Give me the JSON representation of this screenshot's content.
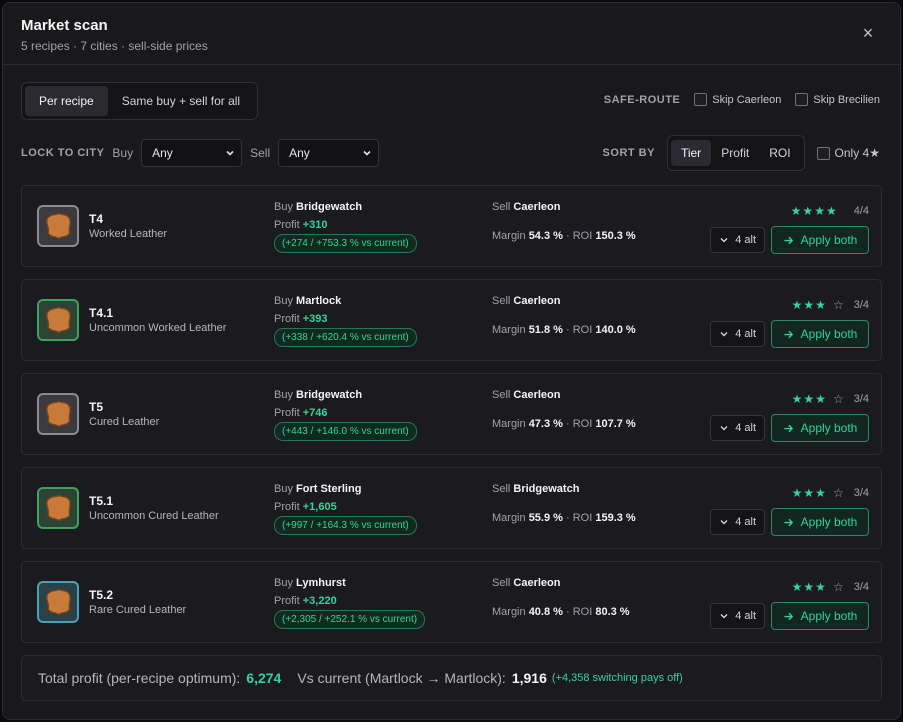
{
  "header": {
    "title": "Market scan",
    "subtitle": "5 recipes · 7 cities · sell-side prices",
    "close": "×"
  },
  "mode_tabs": [
    "Per recipe",
    "Same buy + sell for all"
  ],
  "safe_route": {
    "label": "SAFE-ROUTE",
    "options": [
      "Skip Caerleon",
      "Skip Brecilien"
    ]
  },
  "lock": {
    "label": "LOCK TO CITY",
    "buy_label": "Buy",
    "buy_value": "Any",
    "sell_label": "Sell",
    "sell_value": "Any"
  },
  "sort": {
    "label": "SORT BY",
    "options": [
      "Tier",
      "Profit",
      "ROI"
    ],
    "active": "Tier",
    "only_label": "Only 4★"
  },
  "recipes": [
    {
      "tier": "T4",
      "name": "Worked Leather",
      "buy_label": "Buy",
      "buy_city": "Bridgewatch",
      "profit_label": "Profit",
      "profit": "+310",
      "delta": "(+274 / +753.3 % vs current)",
      "sell_label": "Sell",
      "sell_city": "Caerleon",
      "margin_label": "Margin",
      "margin": "54.3 %",
      "roi_label": "· ROI",
      "roi": "150.3 %",
      "stars_filled": "★★★★",
      "stars_empty": "",
      "stars_count": "4/4",
      "alt": "4 alt",
      "apply": "Apply both",
      "frame": "gray"
    },
    {
      "tier": "T4.1",
      "name": "Uncommon Worked Leather",
      "buy_label": "Buy",
      "buy_city": "Martlock",
      "profit_label": "Profit",
      "profit": "+393",
      "delta": "(+338 / +620.4 % vs current)",
      "sell_label": "Sell",
      "sell_city": "Caerleon",
      "margin_label": "Margin",
      "margin": "51.8 %",
      "roi_label": "· ROI",
      "roi": "140.0 %",
      "stars_filled": "★★★",
      "stars_empty": "☆",
      "stars_count": "3/4",
      "alt": "4 alt",
      "apply": "Apply both",
      "frame": "green"
    },
    {
      "tier": "T5",
      "name": "Cured Leather",
      "buy_label": "Buy",
      "buy_city": "Bridgewatch",
      "profit_label": "Profit",
      "profit": "+746",
      "delta": "(+443 / +146.0 % vs current)",
      "sell_label": "Sell",
      "sell_city": "Caerleon",
      "margin_label": "Margin",
      "margin": "47.3 %",
      "roi_label": "· ROI",
      "roi": "107.7 %",
      "stars_filled": "★★★",
      "stars_empty": "☆",
      "stars_count": "3/4",
      "alt": "4 alt",
      "apply": "Apply both",
      "frame": "gray"
    },
    {
      "tier": "T5.1",
      "name": "Uncommon Cured Leather",
      "buy_label": "Buy",
      "buy_city": "Fort Sterling",
      "profit_label": "Profit",
      "profit": "+1,605",
      "delta": "(+997 / +164.3 % vs current)",
      "sell_label": "Sell",
      "sell_city": "Bridgewatch",
      "margin_label": "Margin",
      "margin": "55.9 %",
      "roi_label": "· ROI",
      "roi": "159.3 %",
      "stars_filled": "★★★",
      "stars_empty": "☆",
      "stars_count": "3/4",
      "alt": "4 alt",
      "apply": "Apply both",
      "frame": "green"
    },
    {
      "tier": "T5.2",
      "name": "Rare Cured Leather",
      "buy_label": "Buy",
      "buy_city": "Lymhurst",
      "profit_label": "Profit",
      "profit": "+3,220",
      "delta": "(+2,305 / +252.1 % vs current)",
      "sell_label": "Sell",
      "sell_city": "Caerleon",
      "margin_label": "Margin",
      "margin": "40.8 %",
      "roi_label": "· ROI",
      "roi": "80.3 %",
      "stars_filled": "★★★",
      "stars_empty": "☆",
      "stars_count": "3/4",
      "alt": "4 alt",
      "apply": "Apply both",
      "frame": "blue"
    }
  ],
  "footer": {
    "total_label": "Total profit (per-recipe optimum):",
    "total": "6,274",
    "vs_label": "Vs current (Martlock → Martlock):",
    "vs_value": "1,916",
    "note": "(+4,358 switching pays off)"
  },
  "colors": {
    "accent": "#34d399",
    "background": "#19191c",
    "card": "#1b1b1f"
  }
}
